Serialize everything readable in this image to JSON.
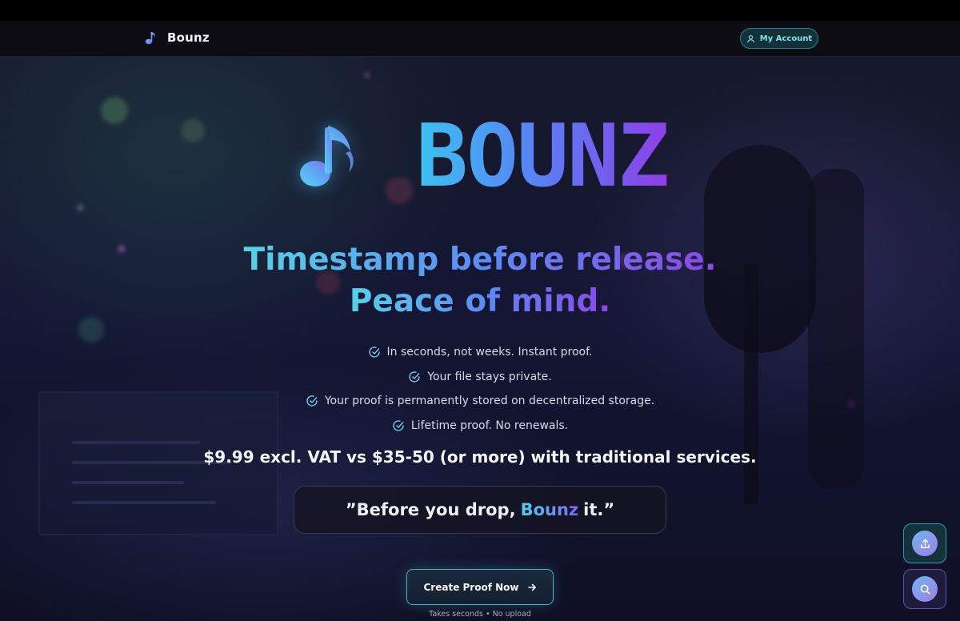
{
  "nav": {
    "brand_name": "Bounz",
    "brand_icon": "music-note-icon",
    "account_label": "My Account",
    "account_icon": "user-icon"
  },
  "hero": {
    "logo_word": "BOUNZ",
    "logo_icon": "music-note-icon",
    "headline_line1": "Timestamp before release.",
    "headline_line2": "Peace of mind.",
    "features": [
      "In seconds, not weeks. Instant proof.",
      "Your file stays private.",
      "Your proof is permanently stored on decentralized storage.",
      "Lifetime proof. No renewals."
    ],
    "feature_icon": "check-circle-icon",
    "pricing": "$9.99 excl. VAT vs $35-50 (or more) with traditional services.",
    "quote_before": "”Before you drop,",
    "quote_brand": "Bounz",
    "quote_after": "it.”",
    "cta_label": "Create Proof Now",
    "cta_icon": "arrow-right-icon",
    "cta_note": "Takes seconds • No upload"
  },
  "floating_actions": {
    "upload_icon": "upload-icon",
    "search_icon": "search-icon"
  },
  "colors": {
    "accent_cyan": "#3cc2f2",
    "accent_blue": "#5a7ef6",
    "accent_purple": "#8e3fe8",
    "background": "#0b0b16"
  }
}
